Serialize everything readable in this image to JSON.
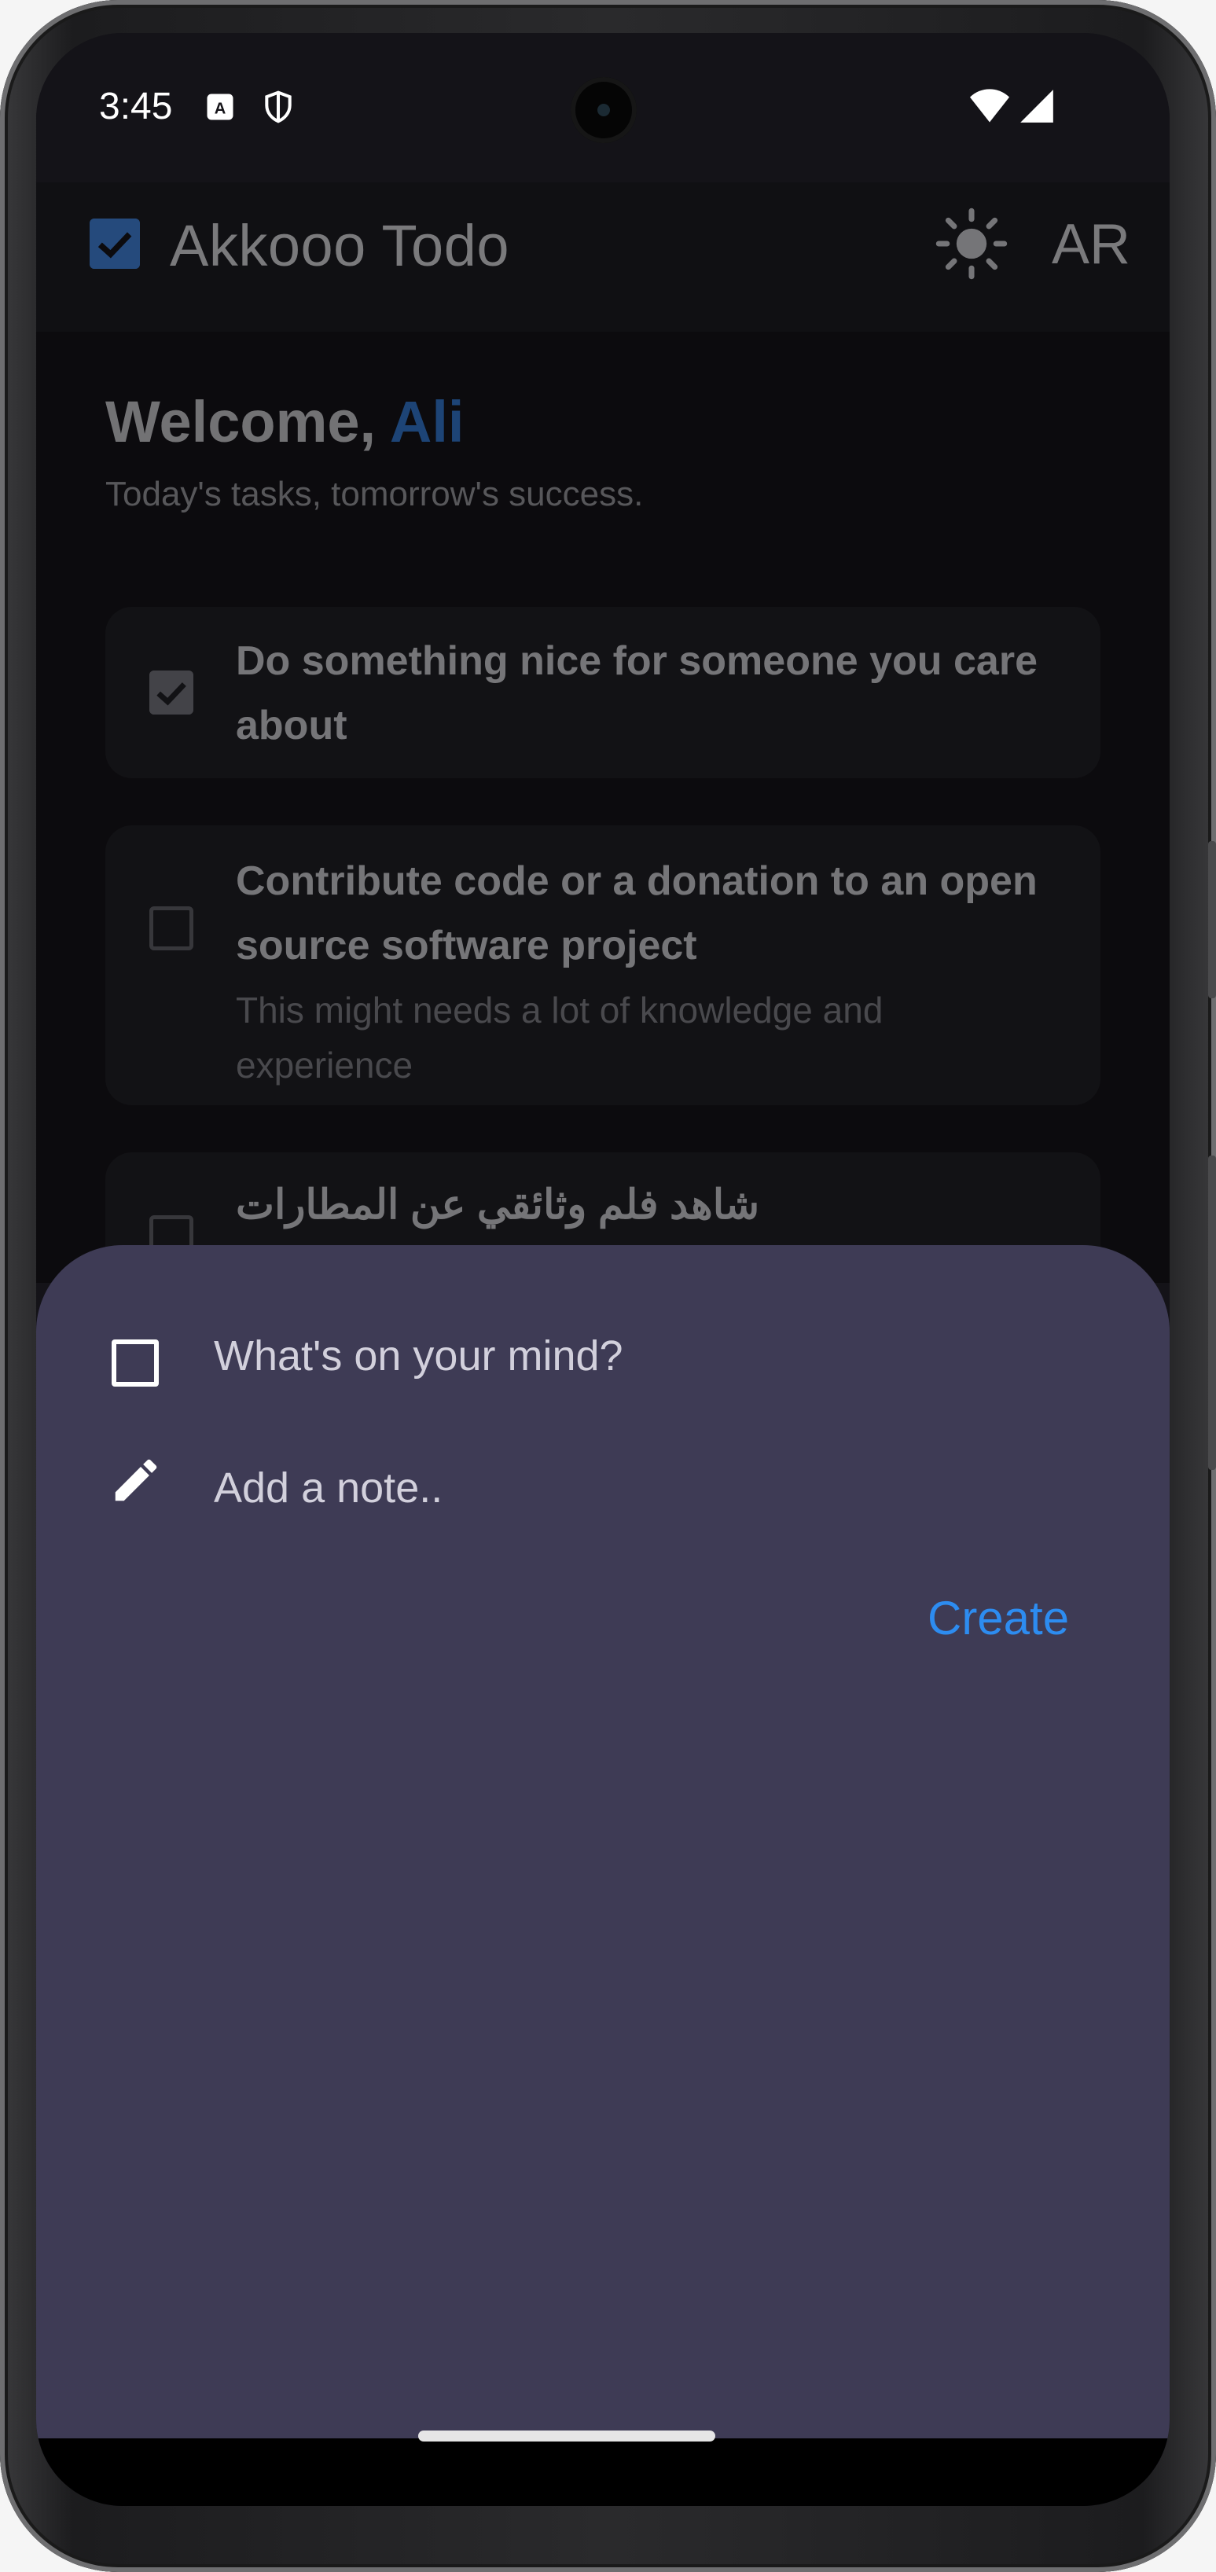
{
  "status_bar": {
    "time": "3:45",
    "notification_icons": [
      "a-box-icon",
      "shield-icon"
    ],
    "system_icons": [
      "wifi-icon",
      "cellular-signal-icon"
    ]
  },
  "app_bar": {
    "title": "Akkooo Todo",
    "theme_toggle_icon": "sun-icon",
    "language_label": "AR",
    "accent_color": "#3c78c8"
  },
  "header": {
    "greeting": "Welcome,",
    "user_name": "Ali",
    "tagline": "Today's tasks, tomorrow's success."
  },
  "tasks": [
    {
      "title_line1": "Do something nice for someone you care",
      "title_line2": "about",
      "note_line1": "",
      "note_line2": "",
      "completed": true
    },
    {
      "title_line1": "Contribute code or a  donation to an open",
      "title_line2": "source software project",
      "note_line1": "This might needs a lot of knowledge and",
      "note_line2": "experience",
      "completed": false
    },
    {
      "title_line1": "شاهد فلم وثائقي عن المطارات",
      "title_line2": "",
      "note_line1": "",
      "note_line2": "",
      "completed": false
    }
  ],
  "sheet": {
    "title_placeholder": "What's on your mind?",
    "note_placeholder": "Add a note..",
    "create_label": "Create",
    "background_color": "#3e3b55",
    "create_color": "#2d8cf0"
  }
}
